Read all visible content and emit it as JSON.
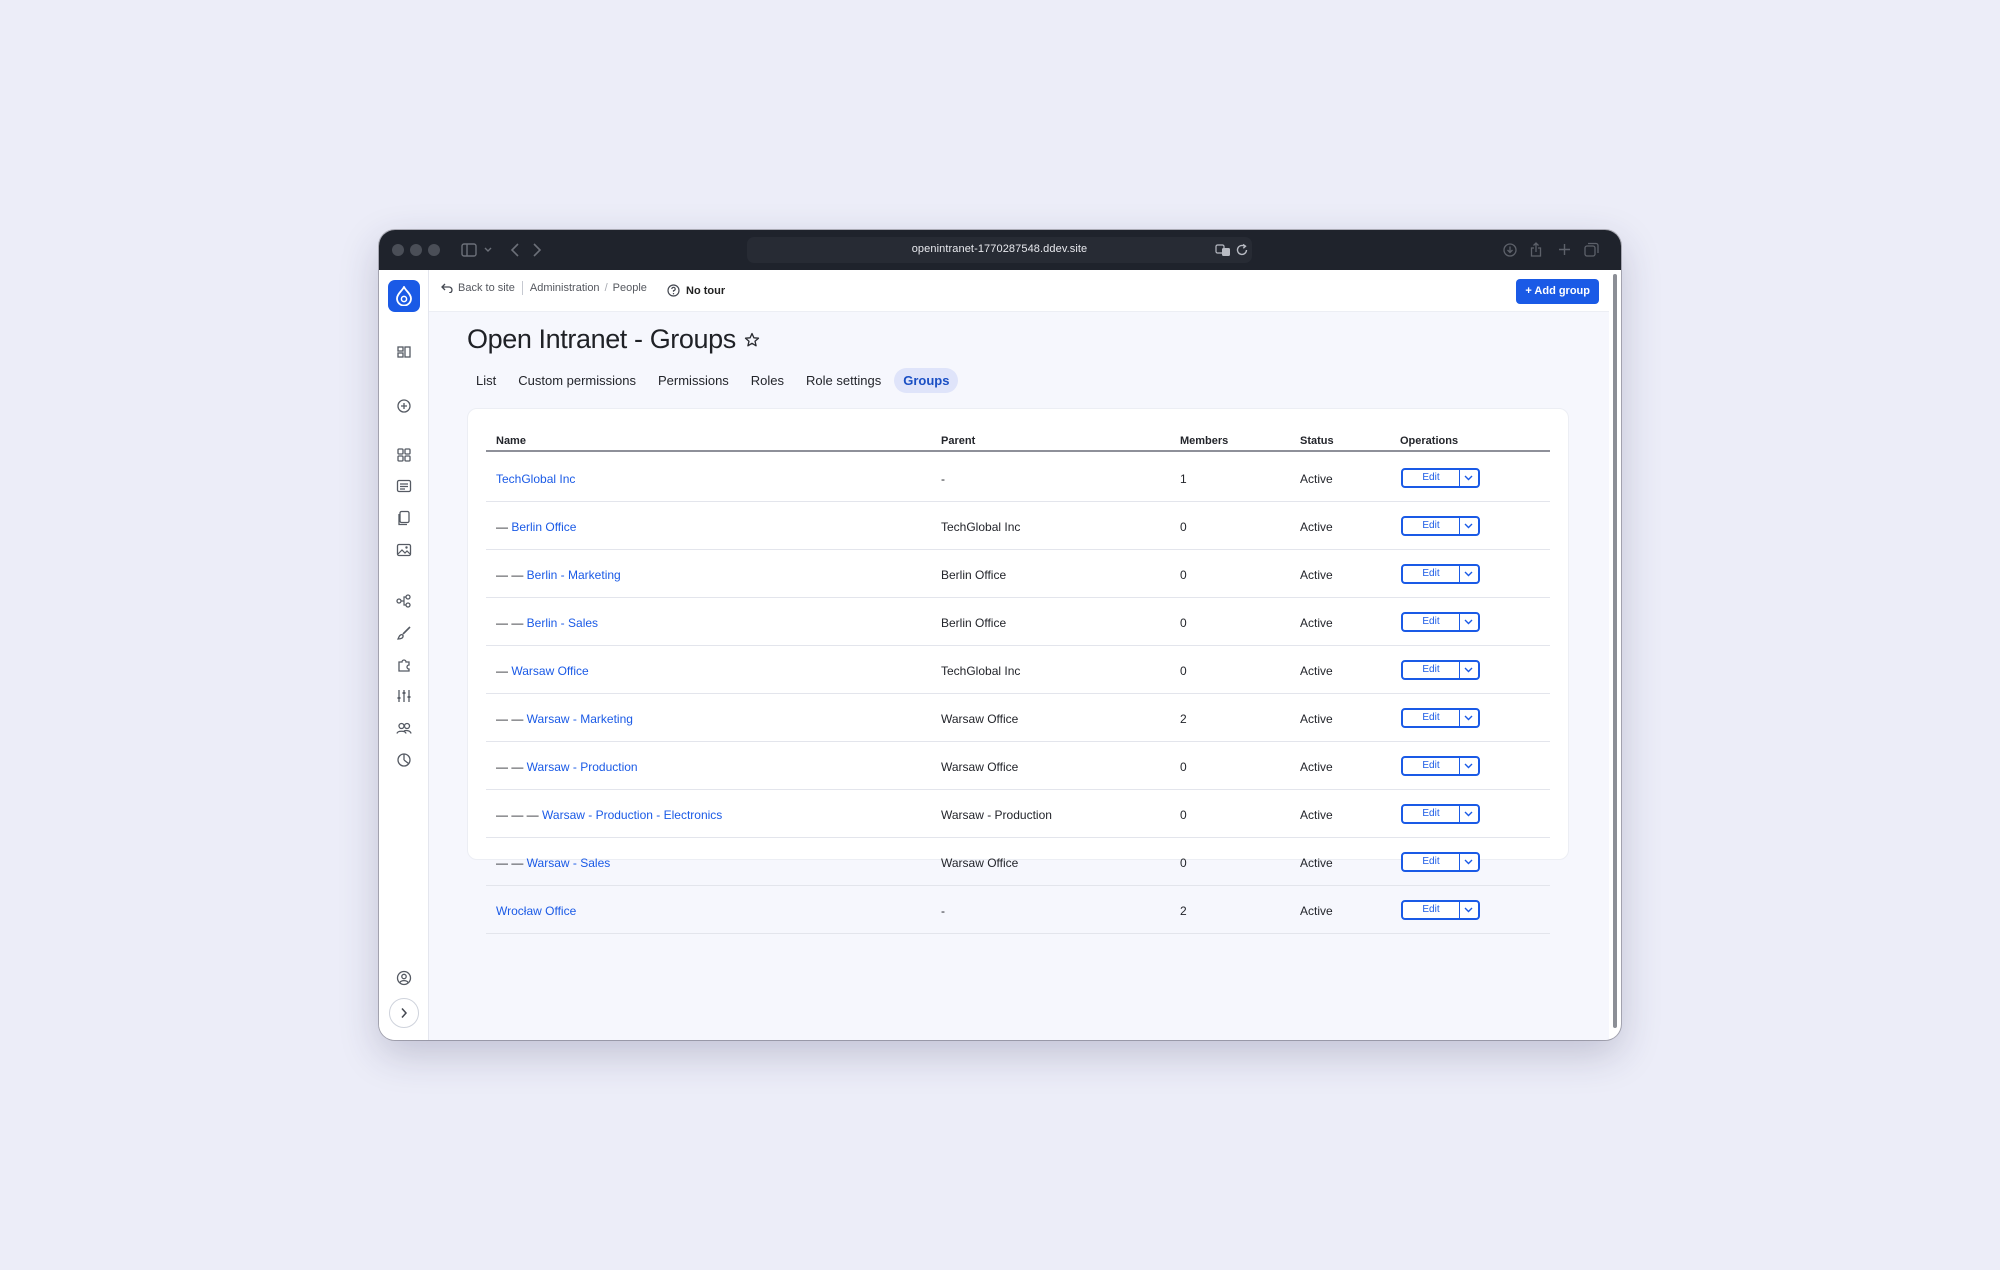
{
  "browser": {
    "url": "openintranet-1770287548.ddev.site"
  },
  "topbar": {
    "back_label": "Back to site",
    "breadcrumb": [
      "Administration",
      "People"
    ],
    "tour_label": "No tour",
    "add_button": "+ Add group"
  },
  "page": {
    "title": "Open Intranet - Groups"
  },
  "tabs": [
    {
      "label": "List",
      "active": false
    },
    {
      "label": "Custom permissions",
      "active": false
    },
    {
      "label": "Permissions",
      "active": false
    },
    {
      "label": "Roles",
      "active": false
    },
    {
      "label": "Role settings",
      "active": false
    },
    {
      "label": "Groups",
      "active": true
    }
  ],
  "table": {
    "columns": [
      "Name",
      "Parent",
      "Members",
      "Status",
      "Operations"
    ],
    "edit_label": "Edit",
    "rows": [
      {
        "indent": "",
        "name": "TechGlobal Inc",
        "parent": "-",
        "members": "1",
        "status": "Active"
      },
      {
        "indent": "— ",
        "name": "Berlin Office",
        "parent": "TechGlobal Inc",
        "members": "0",
        "status": "Active"
      },
      {
        "indent": "— — ",
        "name": "Berlin - Marketing",
        "parent": "Berlin Office",
        "members": "0",
        "status": "Active"
      },
      {
        "indent": "— — ",
        "name": "Berlin - Sales",
        "parent": "Berlin Office",
        "members": "0",
        "status": "Active"
      },
      {
        "indent": "— ",
        "name": "Warsaw Office",
        "parent": "TechGlobal Inc",
        "members": "0",
        "status": "Active"
      },
      {
        "indent": "— — ",
        "name": "Warsaw - Marketing",
        "parent": "Warsaw Office",
        "members": "2",
        "status": "Active"
      },
      {
        "indent": "— — ",
        "name": "Warsaw - Production",
        "parent": "Warsaw Office",
        "members": "0",
        "status": "Active"
      },
      {
        "indent": "— — — ",
        "name": "Warsaw - Production - Electronics",
        "parent": "Warsaw - Production",
        "members": "0",
        "status": "Active"
      },
      {
        "indent": "— — ",
        "name": "Warsaw - Sales",
        "parent": "Warsaw Office",
        "members": "0",
        "status": "Active"
      },
      {
        "indent": "",
        "name": "Wrocław Office",
        "parent": "-",
        "members": "2",
        "status": "Active"
      }
    ]
  },
  "sidebar": {
    "icons": [
      "dashboard-icon",
      "add-content-icon",
      "content-icon",
      "structure-list-icon",
      "files-icon",
      "media-icon",
      "workflow-icon",
      "appearance-brush-icon",
      "extend-puzzle-icon",
      "configuration-sliders-icon",
      "people-icon",
      "reports-icon",
      "user-account-icon"
    ]
  },
  "colors": {
    "accent": "#1a5ae6",
    "background": "#ecedf8",
    "chrome": "#1f232c"
  }
}
